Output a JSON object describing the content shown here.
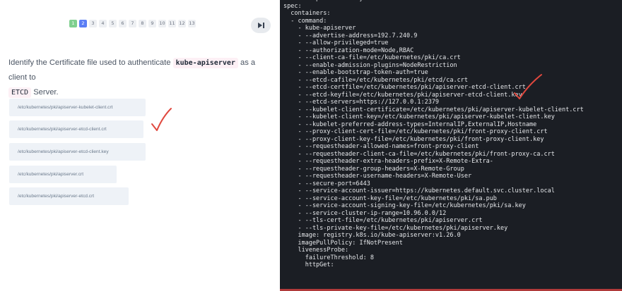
{
  "quiz": {
    "pages": [
      "1",
      "2",
      "3",
      "4",
      "5",
      "6",
      "7",
      "8",
      "9",
      "10",
      "11",
      "12",
      "13"
    ],
    "question": {
      "part1": "Identify the Certificate file used to authenticate",
      "code1": "kube-apiserver",
      "part2": "as a client to",
      "code2": "ETCD",
      "part3": "Server."
    },
    "options": [
      "/etc/kubernetes/pki/apiserver-kubelet-client.crt",
      "/etc/kubernetes/pki/apiserver-etcd-client.crt",
      "/etc/kubernetes/pki/apiserver-etcd-client.key",
      "/etc/kubernetes/pki/apiserver.crt",
      "/etc/kubernetes/pki/apiserver-etcd.crt"
    ],
    "skip_icon": "skip-forward-icon",
    "check_color": "#e0483e"
  },
  "terminal": {
    "lines": [
      "    namespace: kube-system",
      "spec:",
      "  containers:",
      "  - command:",
      "    - kube-apiserver",
      "    - --advertise-address=192.7.240.9",
      "    - --allow-privileged=true",
      "    - --authorization-mode=Node,RBAC",
      "    - --client-ca-file=/etc/kubernetes/pki/ca.crt",
      "    - --enable-admission-plugins=NodeRestriction",
      "    - --enable-bootstrap-token-auth=true",
      "    - --etcd-cafile=/etc/kubernetes/pki/etcd/ca.crt",
      "    - --etcd-certfile=/etc/kubernetes/pki/apiserver-etcd-client.crt",
      "    - --etcd-keyfile=/etc/kubernetes/pki/apiserver-etcd-client.key",
      "    - --etcd-servers=https://127.0.0.1:2379",
      "    - --kubelet-client-certificate=/etc/kubernetes/pki/apiserver-kubelet-client.crt",
      "    - --kubelet-client-key=/etc/kubernetes/pki/apiserver-kubelet-client.key",
      "    - --kubelet-preferred-address-types=InternalIP,ExternalIP,Hostname",
      "    - --proxy-client-cert-file=/etc/kubernetes/pki/front-proxy-client.crt",
      "    - --proxy-client-key-file=/etc/kubernetes/pki/front-proxy-client.key",
      "    - --requestheader-allowed-names=front-proxy-client",
      "    - --requestheader-client-ca-file=/etc/kubernetes/pki/front-proxy-ca.crt",
      "    - --requestheader-extra-headers-prefix=X-Remote-Extra-",
      "    - --requestheader-group-headers=X-Remote-Group",
      "    - --requestheader-username-headers=X-Remote-User",
      "    - --secure-port=6443",
      "    - --service-account-issuer=https://kubernetes.default.svc.cluster.local",
      "    - --service-account-key-file=/etc/kubernetes/pki/sa.pub",
      "    - --service-account-signing-key-file=/etc/kubernetes/pki/sa.key",
      "    - --service-cluster-ip-range=10.96.0.0/12",
      "    - --tls-cert-file=/etc/kubernetes/pki/apiserver.crt",
      "    - --tls-private-key-file=/etc/kubernetes/pki/apiserver.key",
      "    image: registry.k8s.io/kube-apiserver:v1.26.0",
      "    imagePullPolicy: IfNotPresent",
      "    livenessProbe:",
      "      failureThreshold: 8",
      "      httpGet:"
    ]
  }
}
